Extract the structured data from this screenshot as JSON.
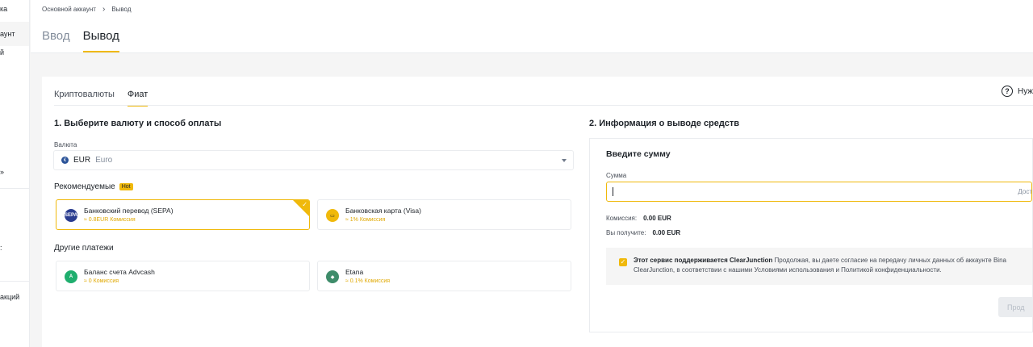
{
  "sidebar": {
    "items": [
      {
        "label": "ка"
      },
      {
        "label": "аунт"
      },
      {
        "label": "й"
      },
      {
        "label": "»"
      },
      {
        "label": ":"
      },
      {
        "label": "акций"
      }
    ]
  },
  "breadcrumb": {
    "parent": "Основной аккаунт",
    "separator": "›",
    "current": "Вывод"
  },
  "top_tabs": [
    {
      "label": "Ввод"
    },
    {
      "label": "Вывод"
    }
  ],
  "sub_tabs": [
    {
      "label": "Криптовалюты"
    },
    {
      "label": "Фиат"
    }
  ],
  "help": {
    "icon": "question-circle-icon",
    "label": "Нуж"
  },
  "left": {
    "title": "1. Выберите валюту и способ оплаты",
    "currency_label": "Валюта",
    "currency_code": "EUR",
    "currency_name": "Euro",
    "recommended_label": "Рекомендуемые",
    "hot_badge": "Hot",
    "recommended": [
      {
        "name": "Банковский перевод (SEPA)",
        "fee": "≈ 0.8EUR Комиссия",
        "icon": "sepa-icon",
        "icon_text": "SEPA",
        "color": "#2a3c8f"
      },
      {
        "name": "Банковская карта (Visa)",
        "fee": "≈ 1% Комиссия",
        "icon": "card-icon",
        "icon_text": "▭",
        "color": "#f0b90b"
      }
    ],
    "other_label": "Другие платежи",
    "other": [
      {
        "name": "Баланс счета Advcash",
        "fee": "≈ 0 Комиссия",
        "icon": "advcash-icon",
        "icon_text": "A",
        "color": "#1fae6e"
      },
      {
        "name": "Etana",
        "fee": "≈ 0.1% Комиссия",
        "icon": "etana-icon",
        "icon_text": "◆",
        "color": "#3e8c6a"
      }
    ]
  },
  "right": {
    "title": "2. Информация о выводе средств",
    "panel_title": "Введите сумму",
    "amount_label": "Сумма",
    "amount_value": "",
    "available_label": "Дост",
    "fee_label": "Комиссия:",
    "fee_value": "0.00 EUR",
    "receive_label": "Вы получите:",
    "receive_value": "0.00 EUR",
    "notice_bold": "Этот сервис поддерживается ClearJunction",
    "notice_text1": " Продолжая, вы даете согласие на передачу личных данных об аккаунте Bina",
    "notice_text2": "ClearJunction, в соответствии с нашими Условиями использования и Политикой конфиденциальности.",
    "button_label": "Прод"
  },
  "colors": {
    "accent": "#f0b90b",
    "text": "#1e2329",
    "muted": "#848e9c"
  }
}
